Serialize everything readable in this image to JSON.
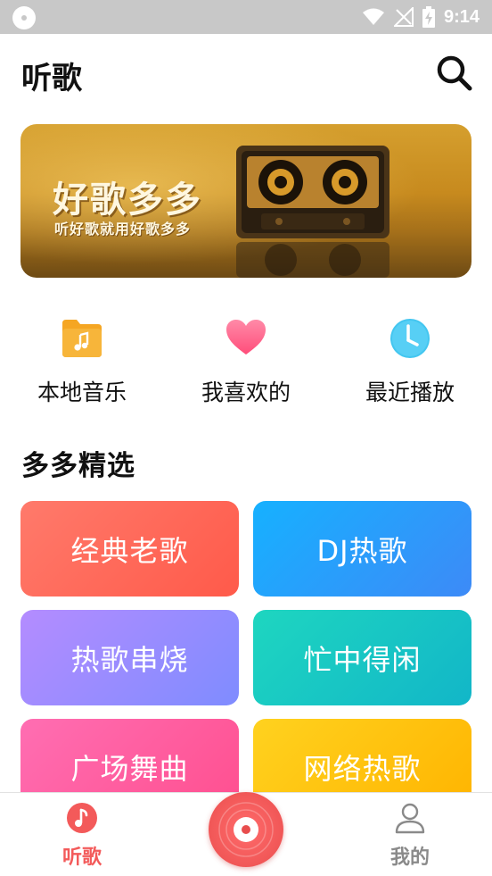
{
  "status_bar": {
    "time": "9:14"
  },
  "header": {
    "title": "听歌",
    "search_icon": "search-icon"
  },
  "banner": {
    "title": "好歌多多",
    "subtitle": "听好歌就用好歌多多"
  },
  "quick_actions": [
    {
      "label": "本地音乐",
      "icon": "music-folder-icon",
      "color": "#f5a623"
    },
    {
      "label": "我喜欢的",
      "icon": "heart-icon",
      "color": "#ff5a7a"
    },
    {
      "label": "最近播放",
      "icon": "clock-icon",
      "color": "#43c6f0"
    }
  ],
  "section": {
    "title": "多多精选"
  },
  "categories": [
    {
      "label": "经典老歌",
      "colors": [
        "#ff7a6b",
        "#ff5a4a"
      ]
    },
    {
      "label": "DJ热歌",
      "colors": [
        "#16b1ff",
        "#3d8af7"
      ]
    },
    {
      "label": "热歌串烧",
      "colors": [
        "#b48cff",
        "#7f8cff"
      ]
    },
    {
      "label": "忙中得闲",
      "colors": [
        "#1ed6c0",
        "#12b6c8"
      ]
    },
    {
      "label": "广场舞曲",
      "colors": [
        "#ff6eb2",
        "#ff4f8f"
      ]
    },
    {
      "label": "网络热歌",
      "colors": [
        "#ffd21f",
        "#ffb400"
      ]
    }
  ],
  "bottom_nav": {
    "items": [
      {
        "label": "听歌",
        "icon": "music-note-icon",
        "active": true
      },
      {
        "label": "我的",
        "icon": "user-icon",
        "active": false
      }
    ],
    "center_icon": "vinyl-disc-icon"
  },
  "colors": {
    "accent": "#f35a5a",
    "inactive": "#8a8a8a"
  }
}
